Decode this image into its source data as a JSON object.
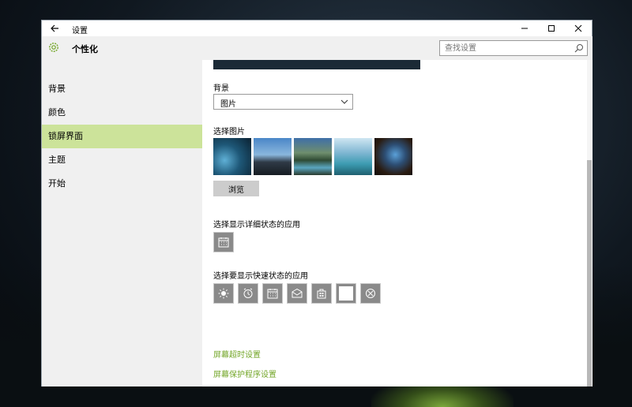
{
  "window": {
    "title": "设置"
  },
  "header": {
    "title": "个性化"
  },
  "search": {
    "placeholder": "查找设置"
  },
  "sidebar": {
    "items": [
      {
        "label": "背景",
        "active": false
      },
      {
        "label": "颜色",
        "active": false
      },
      {
        "label": "锁屏界面",
        "active": true
      },
      {
        "label": "主题",
        "active": false
      },
      {
        "label": "开始",
        "active": false
      }
    ]
  },
  "content": {
    "background_label": "背景",
    "background_value": "图片",
    "choose_picture_label": "选择图片",
    "browse_label": "浏览",
    "detailed_status_label": "选择显示详细状态的应用",
    "quick_status_label": "选择要显示快速状态的应用",
    "screen_timeout_link": "屏幕超时设置",
    "screensaver_link": "屏幕保护程序设置"
  },
  "colors": {
    "accent": "#73a628",
    "nav_active": "#cce39a",
    "tile": "#8a8a8a"
  },
  "icons": {
    "detailed_app": "calendar-icon",
    "quick_apps": [
      "weather-icon",
      "alarm-icon",
      "calendar-icon",
      "mail-icon",
      "store-icon",
      "empty-slot-icon",
      "xbox-icon"
    ]
  }
}
